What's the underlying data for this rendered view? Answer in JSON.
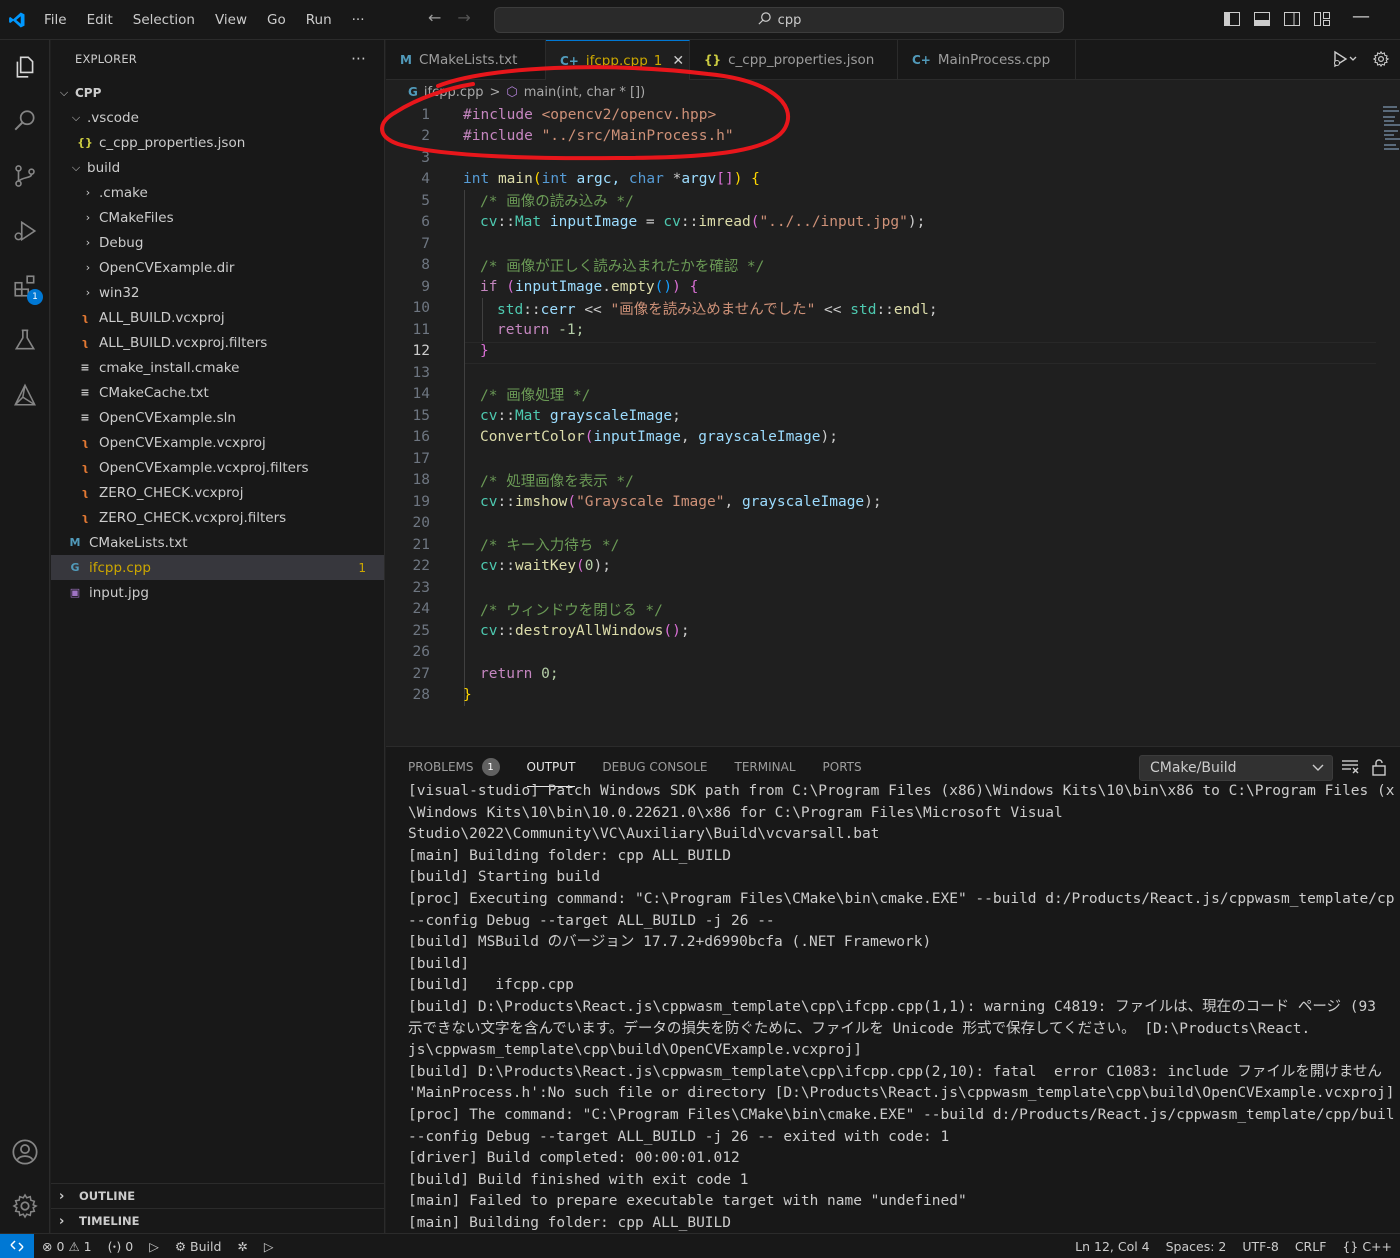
{
  "titlebar": {
    "menu": [
      "File",
      "Edit",
      "Selection",
      "View",
      "Go",
      "Run",
      "···"
    ],
    "search_text": "cpp"
  },
  "activity_bar": {
    "items": [
      "explorer-icon",
      "search-icon",
      "source-control-icon",
      "run-debug-icon",
      "extensions-icon",
      "testing-icon",
      "cmake-icon"
    ],
    "extensions_badge": "1",
    "bottom": [
      "account-icon",
      "settings-gear-icon"
    ]
  },
  "sidebar": {
    "title": "EXPLORER",
    "more": "···",
    "root": "CPP",
    "items": [
      {
        "label": ".vscode",
        "type": "folder-open"
      },
      {
        "label": "c_cpp_properties.json",
        "type": "json"
      },
      {
        "label": "build",
        "type": "folder-open"
      },
      {
        "label": ".cmake",
        "type": "folder"
      },
      {
        "label": "CMakeFiles",
        "type": "folder"
      },
      {
        "label": "Debug",
        "type": "folder"
      },
      {
        "label": "OpenCVExample.dir",
        "type": "folder"
      },
      {
        "label": "win32",
        "type": "folder"
      },
      {
        "label": "ALL_BUILD.vcxproj",
        "type": "rss"
      },
      {
        "label": "ALL_BUILD.vcxproj.filters",
        "type": "rss"
      },
      {
        "label": "cmake_install.cmake",
        "type": "text"
      },
      {
        "label": "CMakeCache.txt",
        "type": "text"
      },
      {
        "label": "OpenCVExample.sln",
        "type": "text"
      },
      {
        "label": "OpenCVExample.vcxproj",
        "type": "rss"
      },
      {
        "label": "OpenCVExample.vcxproj.filters",
        "type": "rss"
      },
      {
        "label": "ZERO_CHECK.vcxproj",
        "type": "rss"
      },
      {
        "label": "ZERO_CHECK.vcxproj.filters",
        "type": "rss"
      },
      {
        "label": "CMakeLists.txt",
        "type": "cmake"
      },
      {
        "label": "ifcpp.cpp",
        "type": "cpp",
        "badge": "1"
      },
      {
        "label": "input.jpg",
        "type": "image"
      }
    ],
    "outline": "OUTLINE",
    "timeline": "TIMELINE"
  },
  "tabs": [
    {
      "label": "CMakeLists.txt",
      "icon": "M"
    },
    {
      "label": "ifcpp.cpp",
      "icon": "C+",
      "count": "1",
      "active": true
    },
    {
      "label": "c_cpp_properties.json",
      "icon": "{}"
    },
    {
      "label": "MainProcess.cpp",
      "icon": "C+"
    }
  ],
  "breadcrumb": {
    "file": "ifcpp.cpp",
    "sep": ">",
    "symbol": "main(int, char * [])"
  },
  "code": {
    "current_line": 12,
    "line_numbers": [
      "1",
      "2",
      "3",
      "4",
      "5",
      "6",
      "7",
      "8",
      "9",
      "10",
      "11",
      "12",
      "13",
      "14",
      "15",
      "16",
      "17",
      "18",
      "19",
      "20",
      "21",
      "22",
      "23",
      "24",
      "25",
      "26",
      "27",
      "28"
    ],
    "l1": {
      "pp": "#include",
      "path": "<opencv2/opencv.hpp>"
    },
    "l2": {
      "pp": "#include",
      "path": "\"../src/MainProcess.h\""
    },
    "l4": {
      "int": "int",
      "main": "main",
      "open": "(",
      "int2": "int",
      "argc": "argc,",
      "char": "char",
      "star": "*",
      "argv": "argv",
      "brk": "[]",
      "close": ")",
      "brace": "{"
    },
    "l5": "/* 画像の読み込み */",
    "l6": {
      "ns": "cv",
      "sep": "::",
      "type": "Mat",
      "var": "inputImage",
      "eq": " = ",
      "ns2": "cv",
      "fn": "imread",
      "open": "(",
      "str": "\"../../input.jpg\"",
      "close": ");"
    },
    "l8": "/* 画像が正しく読み込まれたかを確認 */",
    "l9": {
      "if": "if",
      "open": "(",
      "var": "inputImage",
      "dot": ".",
      "fn": "empty",
      "call": "()",
      "close": ")",
      "brace": "{"
    },
    "l10": {
      "ns": "std",
      "sep": "::",
      "var": "cerr",
      "op": " << ",
      "str": "\"画像を読み込めませんでした\"",
      "op2": " << ",
      "ns2": "std",
      "fn": "endl",
      "semi": ";"
    },
    "l11": {
      "ret": "return",
      "val": " -1;"
    },
    "l12": "}",
    "l14": "/* 画像処理 */",
    "l15": {
      "ns": "cv",
      "sep": "::",
      "type": "Mat",
      "var": "grayscaleImage",
      "semi": ";"
    },
    "l16": {
      "fn": "ConvertColor",
      "open": "(",
      "a1": "inputImage",
      "comma": ", ",
      "a2": "grayscaleImage",
      "close": ");"
    },
    "l18": "/* 処理画像を表示 */",
    "l19": {
      "ns": "cv",
      "sep": "::",
      "fn": "imshow",
      "open": "(",
      "str": "\"Grayscale Image\"",
      "comma": ", ",
      "var": "grayscaleImage",
      "close": ");"
    },
    "l21": "/* キー入力待ち */",
    "l22": {
      "ns": "cv",
      "sep": "::",
      "fn": "waitKey",
      "open": "(",
      "num": "0",
      "close": ");"
    },
    "l24": "/* ウィンドウを閉じる */",
    "l25": {
      "ns": "cv",
      "sep": "::",
      "fn": "destroyAllWindows",
      "call": "()",
      "semi": ";"
    },
    "l27": {
      "ret": "return",
      "val": " 0;"
    },
    "l28": "}"
  },
  "panel": {
    "tabs": [
      "PROBLEMS",
      "OUTPUT",
      "DEBUG CONSOLE",
      "TERMINAL",
      "PORTS"
    ],
    "problems_badge": "1",
    "active_tab": "OUTPUT",
    "channel": "CMake/Build",
    "output_lines": [
      "[visual-studio] Patch Windows SDK path from C:\\Program Files (x86)\\Windows Kits\\10\\bin\\x86 to C:\\Program Files (x",
      "\\Windows Kits\\10\\bin\\10.0.22621.0\\x86 for C:\\Program Files\\Microsoft Visual",
      "Studio\\2022\\Community\\VC\\Auxiliary\\Build\\vcvarsall.bat",
      "[main] Building folder: cpp ALL_BUILD",
      "[build] Starting build",
      "[proc] Executing command: \"C:\\Program Files\\CMake\\bin\\cmake.EXE\" --build d:/Products/React.js/cppwasm_template/cp",
      "--config Debug --target ALL_BUILD -j 26 --",
      "[build] MSBuild のバージョン 17.7.2+d6990bcfa (.NET Framework)",
      "[build]",
      "[build]   ifcpp.cpp",
      "[build] D:\\Products\\React.js\\cppwasm_template\\cpp\\ifcpp.cpp(1,1): warning C4819: ファイルは、現在のコード ページ (93",
      "示できない文字を含んでいます。データの損失を防ぐために、ファイルを Unicode 形式で保存してください。 [D:\\Products\\React.",
      "js\\cppwasm_template\\cpp\\build\\OpenCVExample.vcxproj]",
      "[build] D:\\Products\\React.js\\cppwasm_template\\cpp\\ifcpp.cpp(2,10): fatal  error C1083: include ファイルを開けません",
      "'MainProcess.h':No such file or directory [D:\\Products\\React.js\\cppwasm_template\\cpp\\build\\OpenCVExample.vcxproj]",
      "[proc] The command: \"C:\\Program Files\\CMake\\bin\\cmake.EXE\" --build d:/Products/React.js/cppwasm_template/cpp/buil",
      "--config Debug --target ALL_BUILD -j 26 -- exited with code: 1",
      "[driver] Build completed: 00:00:01.012",
      "[build] Build finished with exit code 1",
      "[main] Failed to prepare executable target with name \"undefined\"",
      "[main] Building folder: cpp ALL_BUILD"
    ]
  },
  "statusbar": {
    "errors": "0",
    "warnings": "1",
    "ports": "0",
    "build": "Build",
    "position": "Ln 12, Col 4",
    "spaces": "Spaces: 2",
    "encoding": "UTF-8",
    "eol": "CRLF",
    "language": "C++",
    "language_icon": "{}"
  },
  "colors": {
    "accent": "#0078d4",
    "warning": "#cca700",
    "annotation": "#e8161b"
  }
}
